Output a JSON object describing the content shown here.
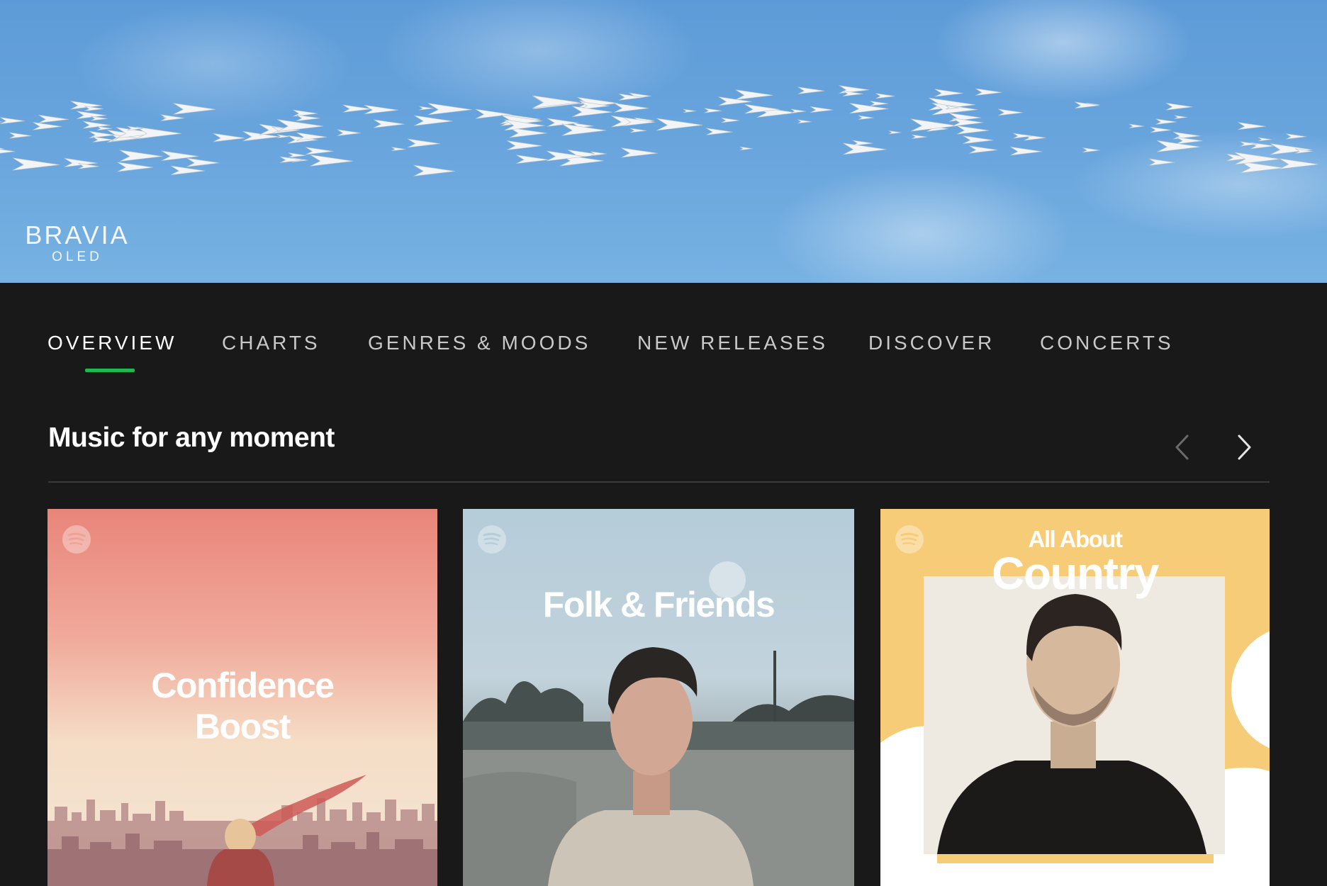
{
  "banner": {
    "brand": "BRAVIA",
    "brand_sub": "OLED"
  },
  "tabs": [
    {
      "label": "OVERVIEW",
      "active": true
    },
    {
      "label": "CHARTS",
      "active": false
    },
    {
      "label": "GENRES & MOODS",
      "active": false
    },
    {
      "label": "NEW RELEASES",
      "active": false
    },
    {
      "label": "DISCOVER",
      "active": false
    },
    {
      "label": "CONCERTS",
      "active": false
    }
  ],
  "section": {
    "title": "Music for any moment",
    "prev_icon": "chevron-left-icon",
    "next_icon": "chevron-right-icon"
  },
  "cards": [
    {
      "title_line1": "Confidence",
      "title_line2": "Boost",
      "icon": "spotify-logo-icon"
    },
    {
      "title": "Folk & Friends",
      "icon": "spotify-logo-icon"
    },
    {
      "title_small": "All About",
      "title_big": "Country",
      "icon": "spotify-logo-icon"
    }
  ],
  "colors": {
    "background": "#191919",
    "accent": "#1db954",
    "sky": "#6aa6dd"
  }
}
